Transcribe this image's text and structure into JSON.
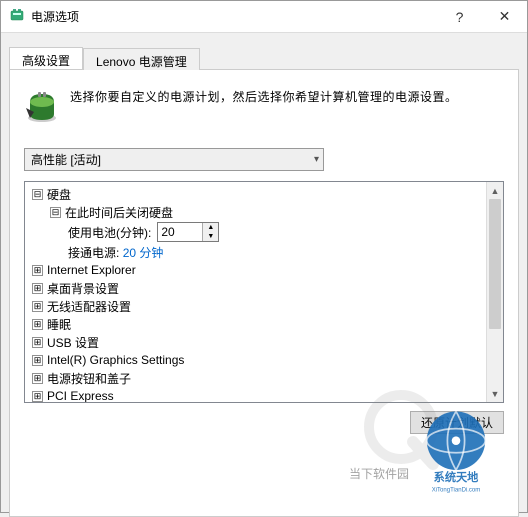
{
  "window": {
    "title": "电源选项",
    "help_glyph": "?",
    "close_glyph": "✕"
  },
  "tabs": {
    "advanced": "高级设置",
    "lenovo": "Lenovo 电源管理"
  },
  "intro": "选择你要自定义的电源计划，然后选择你希望计算机管理的电源设置。",
  "plan_combo": {
    "selected": "高性能 [活动]"
  },
  "tree": {
    "exp_minus": "⊟",
    "exp_plus": "⊞",
    "hdd": "硬盘",
    "hdd_off_after": "在此时间后关闭硬盘",
    "on_battery_label": "使用电池(分钟):",
    "on_battery_value": "20",
    "plugged_label": "接通电源:",
    "plugged_value": "20 分钟",
    "ie": "Internet Explorer",
    "desktop_bg": "桌面背景设置",
    "wireless": "无线适配器设置",
    "sleep": "睡眠",
    "usb": "USB 设置",
    "intel_gfx": "Intel(R) Graphics Settings",
    "power_button": "电源按钮和盖子",
    "pci": "PCI Express"
  },
  "restore_defaults": "还原计划默认",
  "watermark": {
    "site_text": "当下软件园"
  }
}
